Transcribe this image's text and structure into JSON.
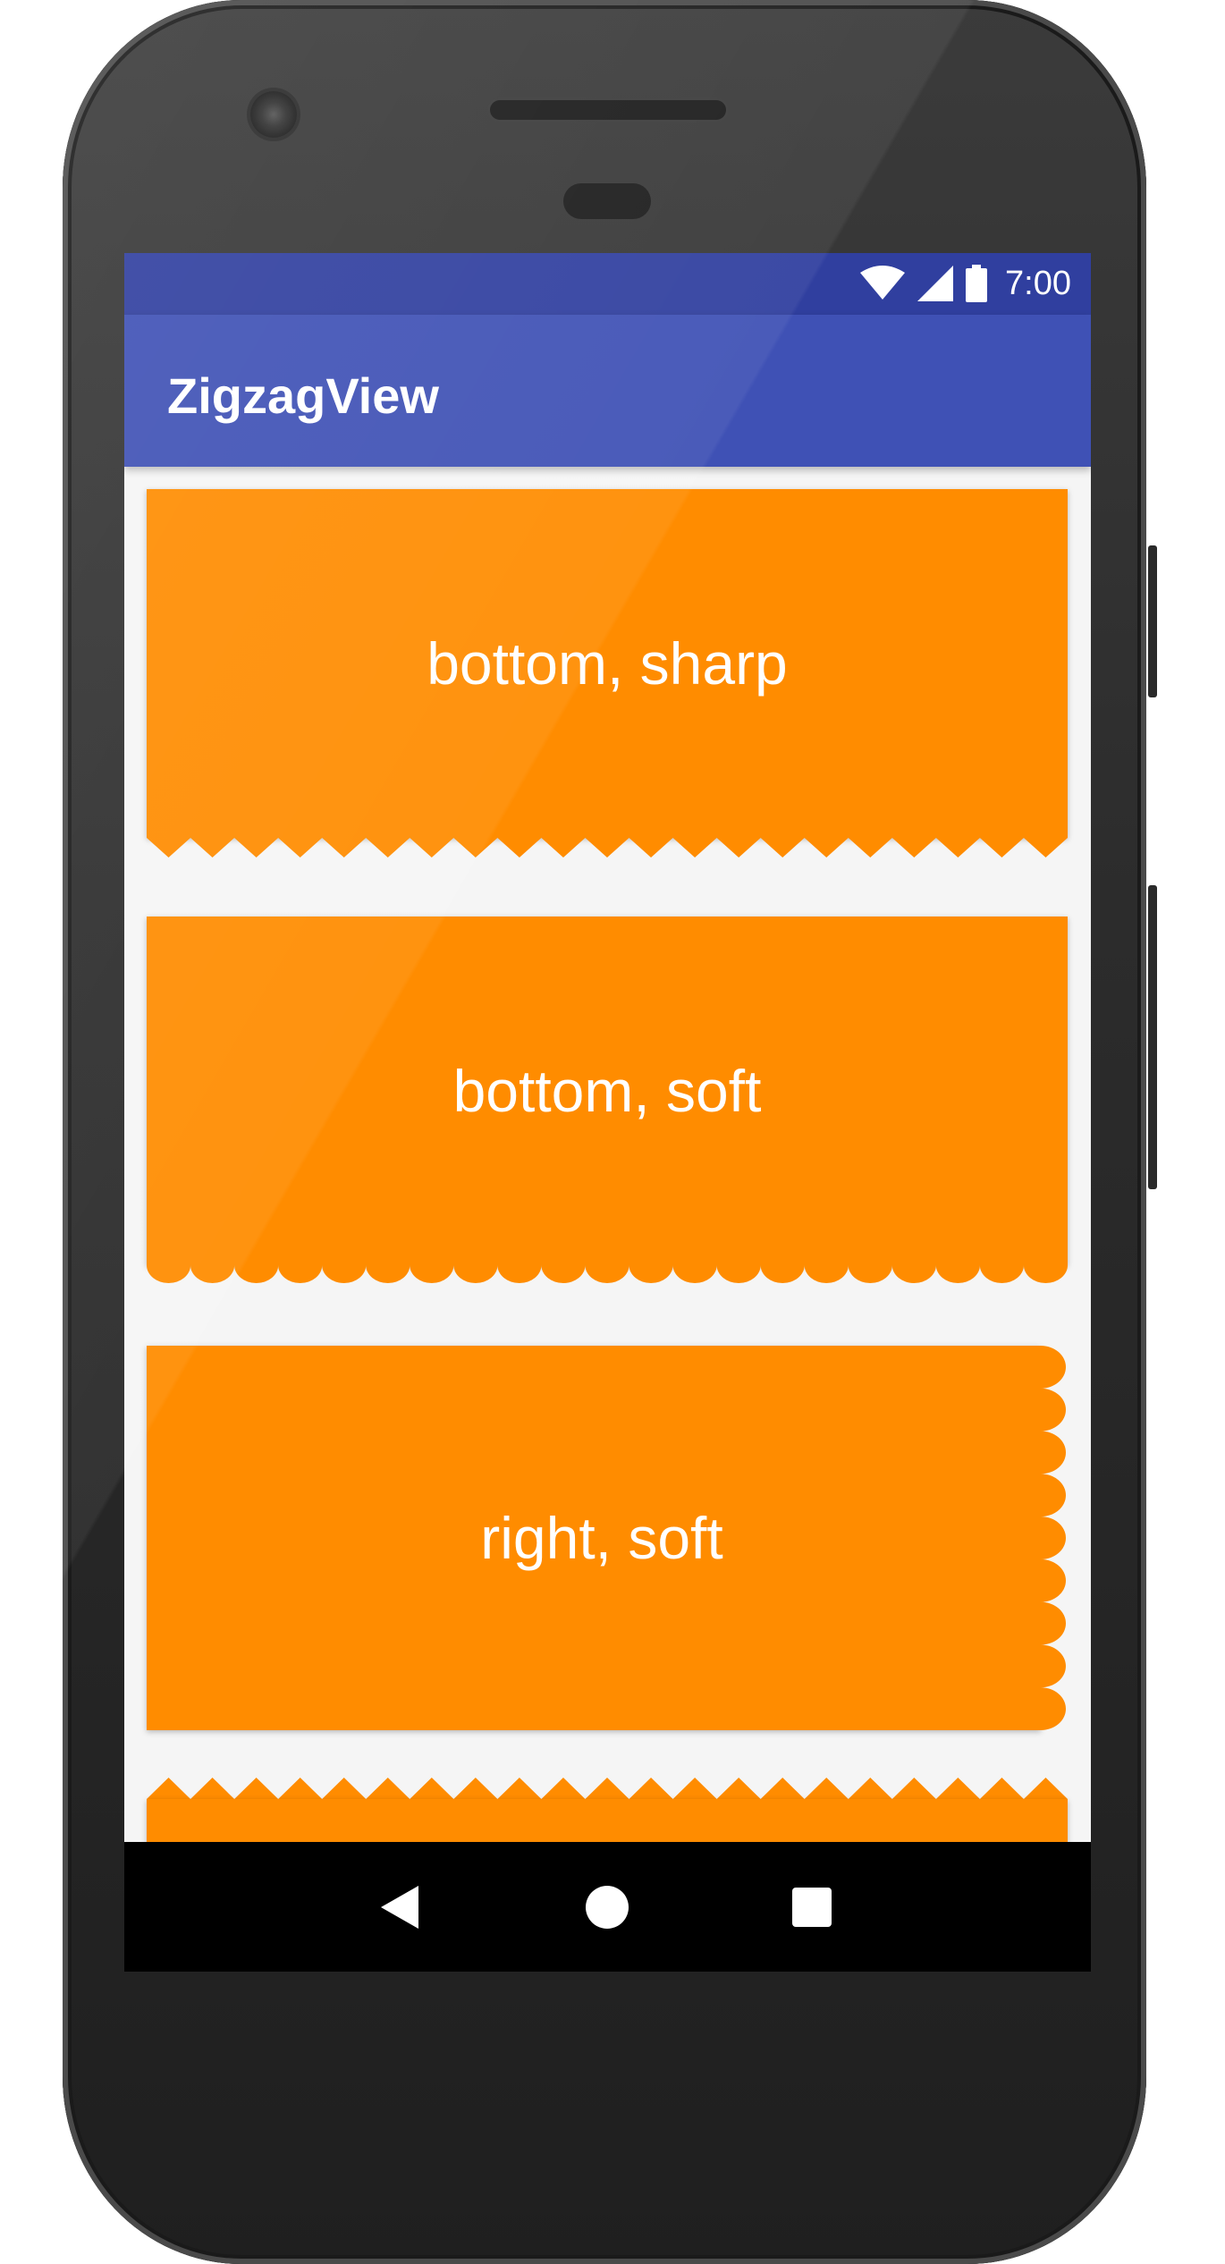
{
  "status_bar": {
    "time": "7:00",
    "icons": [
      "wifi-icon",
      "cellular-signal-icon",
      "battery-icon"
    ],
    "color": "#303f9f"
  },
  "app_bar": {
    "title": "ZigzagView",
    "color": "#3f51b5"
  },
  "cards": [
    {
      "label": "bottom, sharp",
      "zigzag_side": "bottom",
      "zigzag_style": "sharp"
    },
    {
      "label": "bottom, soft",
      "zigzag_side": "bottom",
      "zigzag_style": "soft"
    },
    {
      "label": "right, soft",
      "zigzag_side": "right",
      "zigzag_style": "soft"
    },
    {
      "label": "",
      "zigzag_side": "top",
      "zigzag_style": "sharp"
    }
  ],
  "card_color": "#ff8c00",
  "background_color": "#f5f5f5",
  "nav_bar": {
    "buttons": [
      "back-icon",
      "home-icon",
      "recents-icon"
    ]
  }
}
